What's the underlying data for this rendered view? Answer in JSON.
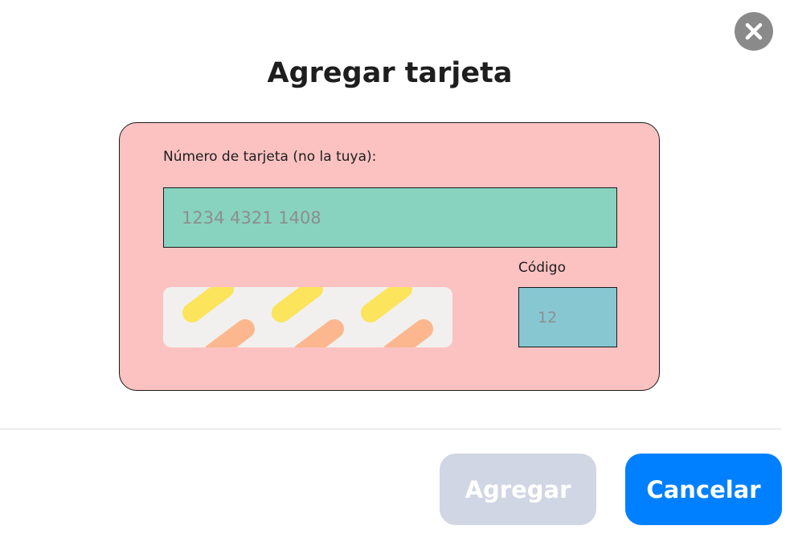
{
  "dialog": {
    "title": "Agregar tarjeta"
  },
  "card": {
    "number_label": "Número de tarjeta (no la tuya):",
    "number_placeholder": "1234 4321 1408",
    "code_label": "Código",
    "code_placeholder": "12"
  },
  "actions": {
    "add_label": "Agregar",
    "cancel_label": "Cancelar"
  },
  "colors": {
    "card_background": "#fcc2c2",
    "number_field": "#87d3bf",
    "code_field": "#87c7d2",
    "add_button_disabled": "#d0d6e3",
    "cancel_button": "#0080ff",
    "close_button": "#8a8a8a",
    "stripe_yellow": "#fce45c",
    "stripe_orange": "#fcb78e"
  },
  "icons": {
    "close": "close-icon",
    "strip": "card-stripe-pattern"
  }
}
